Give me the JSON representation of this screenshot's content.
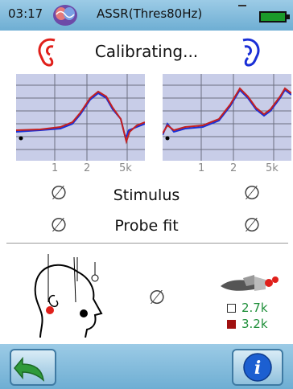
{
  "status": {
    "time": "03:17",
    "mode": "ASSR(Thres80Hz)",
    "battery_level": 0.9
  },
  "calibration": {
    "status_text": "Calibrating..."
  },
  "graph": {
    "tick_labels": [
      "1",
      "2",
      "5k"
    ]
  },
  "checks": {
    "stimulus_label": "Stimulus",
    "probe_fit_label": "Probe fit",
    "status_symbol": "∅"
  },
  "legend": {
    "items": [
      {
        "value": "2.7k"
      },
      {
        "value": "3.2k"
      }
    ]
  },
  "colors": {
    "left_ear": "#e0201b",
    "right_ear": "#1a2fd6",
    "value_green": "#1f8f3a"
  },
  "icons": {
    "left_ear": "left-ear-icon",
    "right_ear": "right-ear-icon",
    "back": "back-arrow-icon",
    "info": "info-icon"
  }
}
